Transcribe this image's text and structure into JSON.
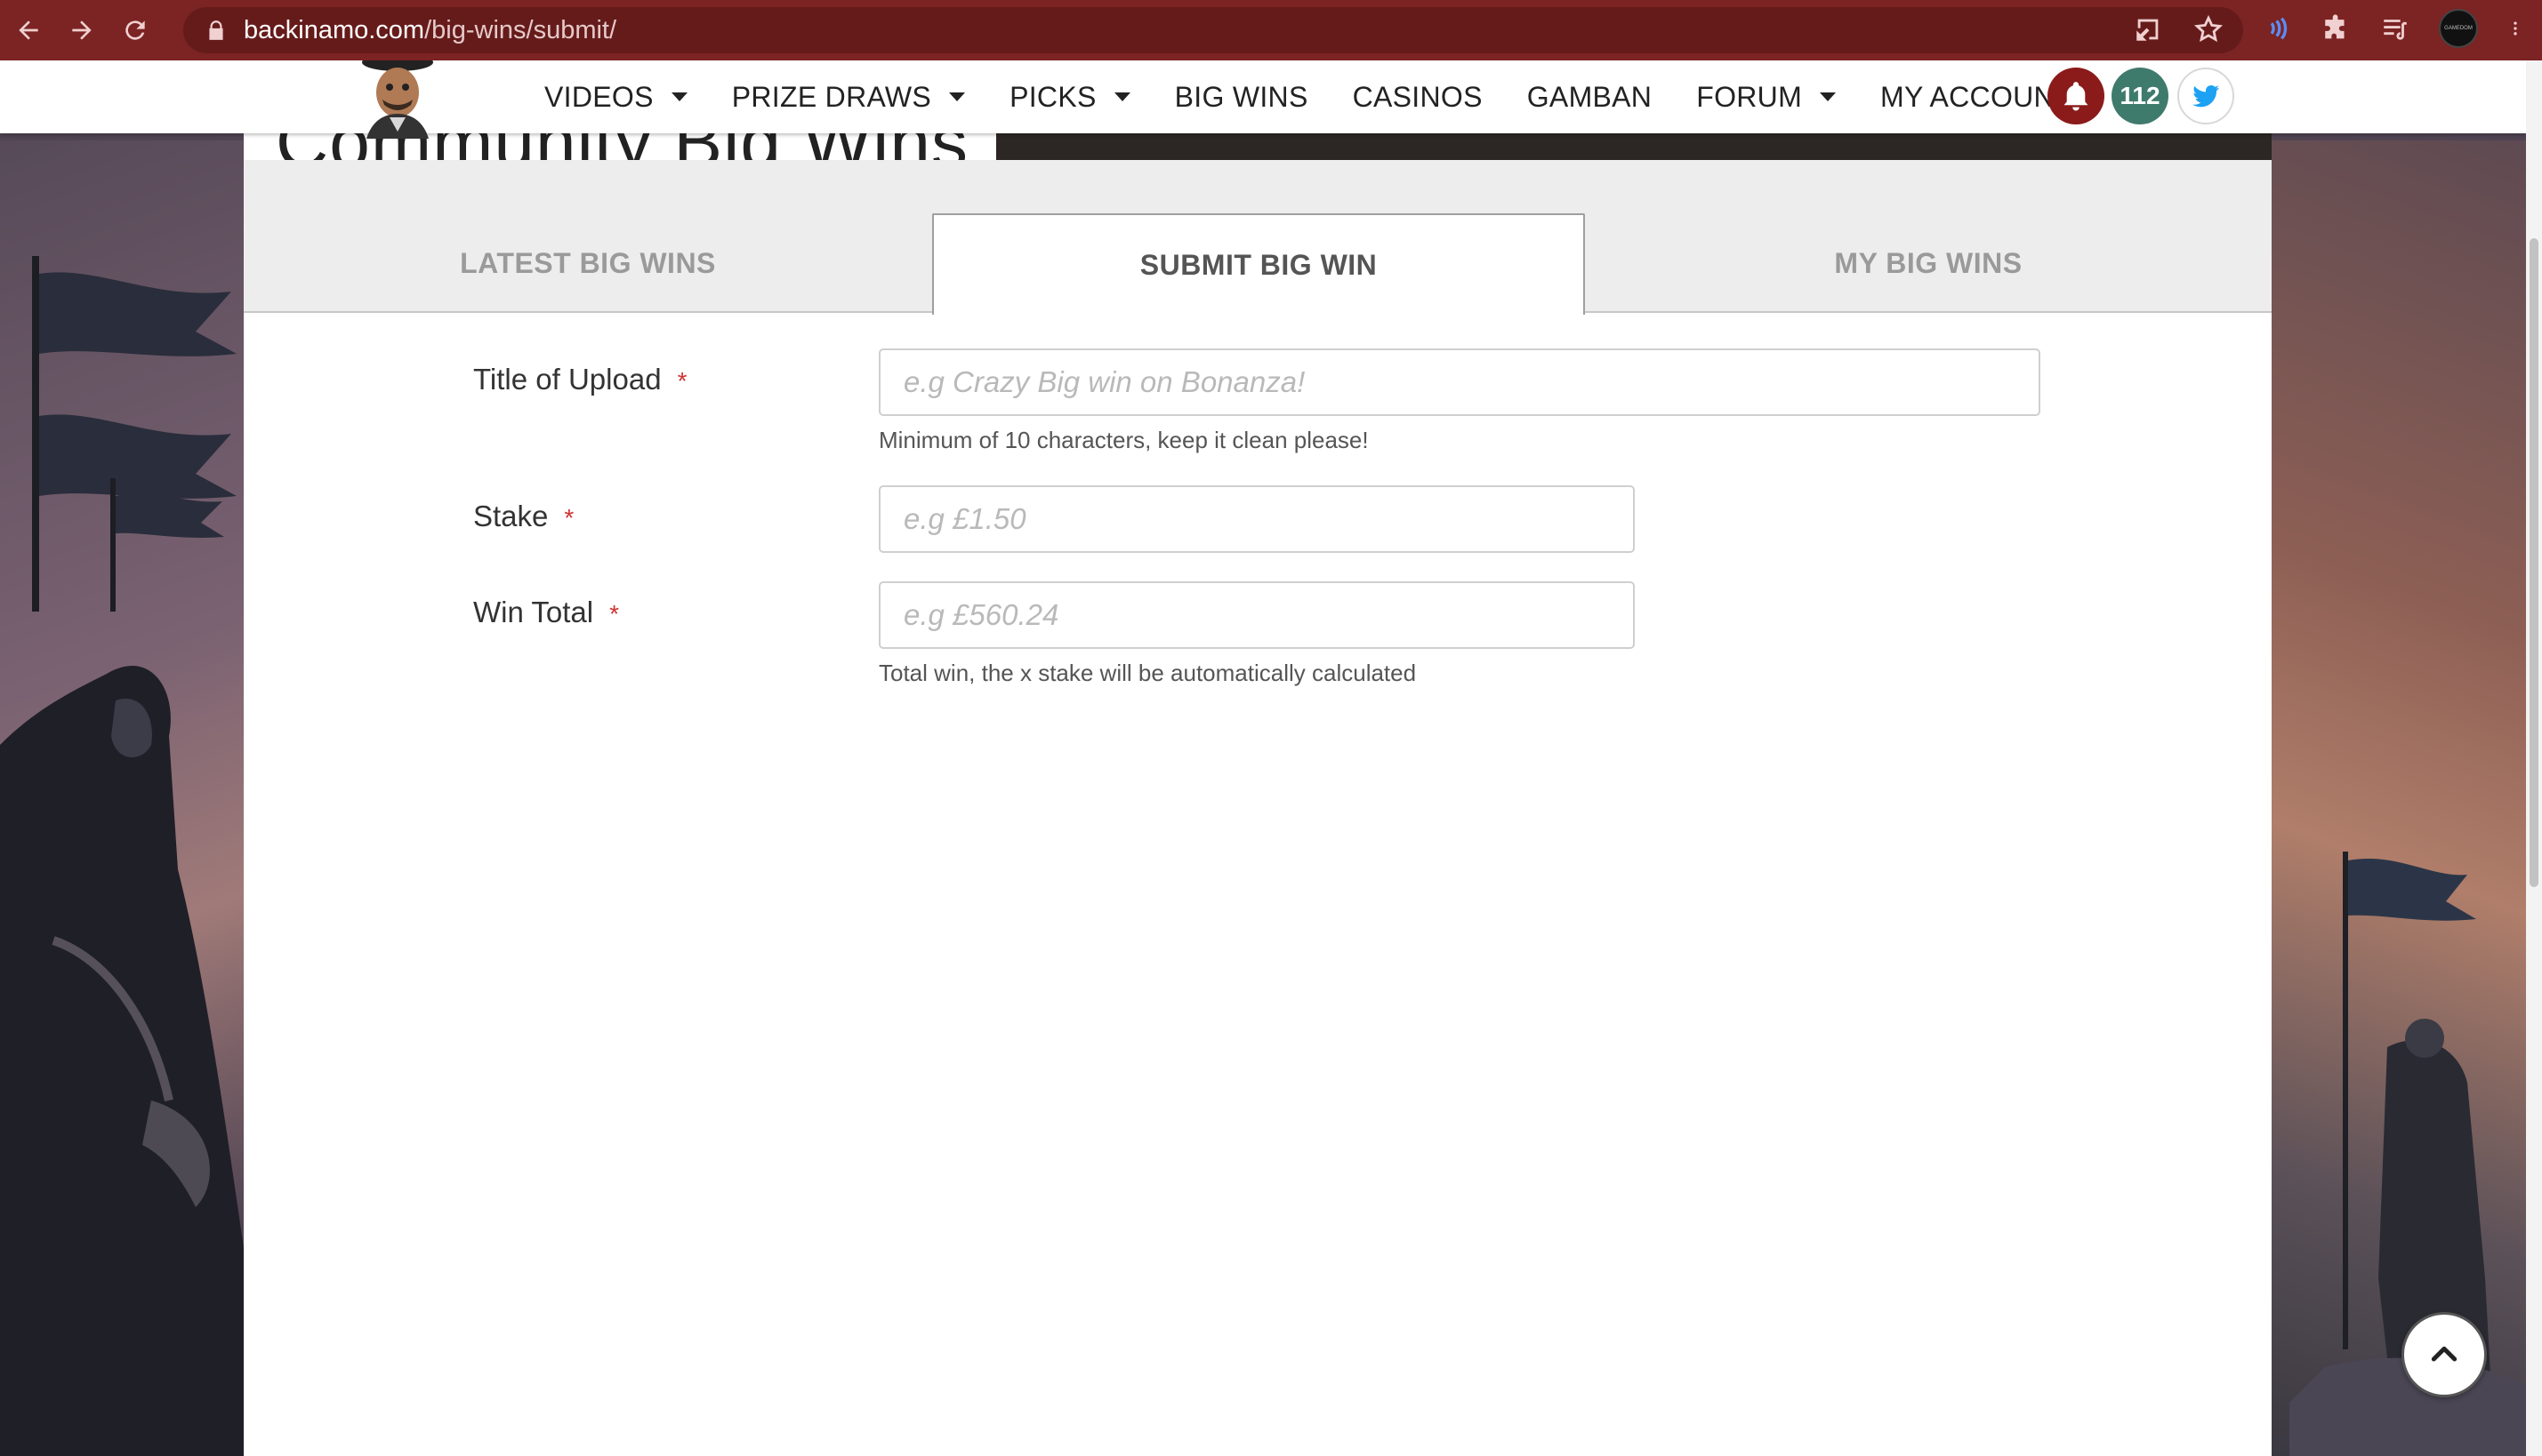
{
  "browser": {
    "url_host": "backinamo.com",
    "url_path": "/big-wins/submit/",
    "profile_label": "GAMEDOM"
  },
  "site_nav": {
    "items": [
      {
        "label": "VIDEOS",
        "dropdown": true
      },
      {
        "label": "PRIZE DRAWS",
        "dropdown": true
      },
      {
        "label": "PICKS",
        "dropdown": true
      },
      {
        "label": "BIG WINS",
        "dropdown": false
      },
      {
        "label": "CASINOS",
        "dropdown": false
      },
      {
        "label": "GAMBAN",
        "dropdown": false
      },
      {
        "label": "FORUM",
        "dropdown": true
      },
      {
        "label": "MY ACCOUNT",
        "dropdown": true
      }
    ],
    "notification_count": "112"
  },
  "page": {
    "title": "Community Big Wins"
  },
  "tabs": [
    {
      "label": "LATEST BIG WINS",
      "active": false
    },
    {
      "label": "SUBMIT BIG WIN",
      "active": true
    },
    {
      "label": "MY BIG WINS",
      "active": false
    }
  ],
  "form": {
    "title_field": {
      "label": "Title of Upload",
      "required_mark": "*",
      "placeholder": "e.g Crazy Big win on Bonanza!",
      "value": "",
      "help": "Minimum of 10 characters, keep it clean please!"
    },
    "stake_field": {
      "label": "Stake",
      "required_mark": "*",
      "placeholder": "e.g £1.50",
      "value": ""
    },
    "win_total_field": {
      "label": "Win Total",
      "required_mark": "*",
      "placeholder": "e.g £560.24",
      "value": "",
      "help": "Total win, the x stake will be automatically calculated"
    }
  },
  "colors": {
    "browser_bar": "#7c2323",
    "bell_badge": "#8b1a1a",
    "count_badge": "#3f7b6c",
    "required": "#d03232",
    "twitter": "#1da1f2"
  }
}
